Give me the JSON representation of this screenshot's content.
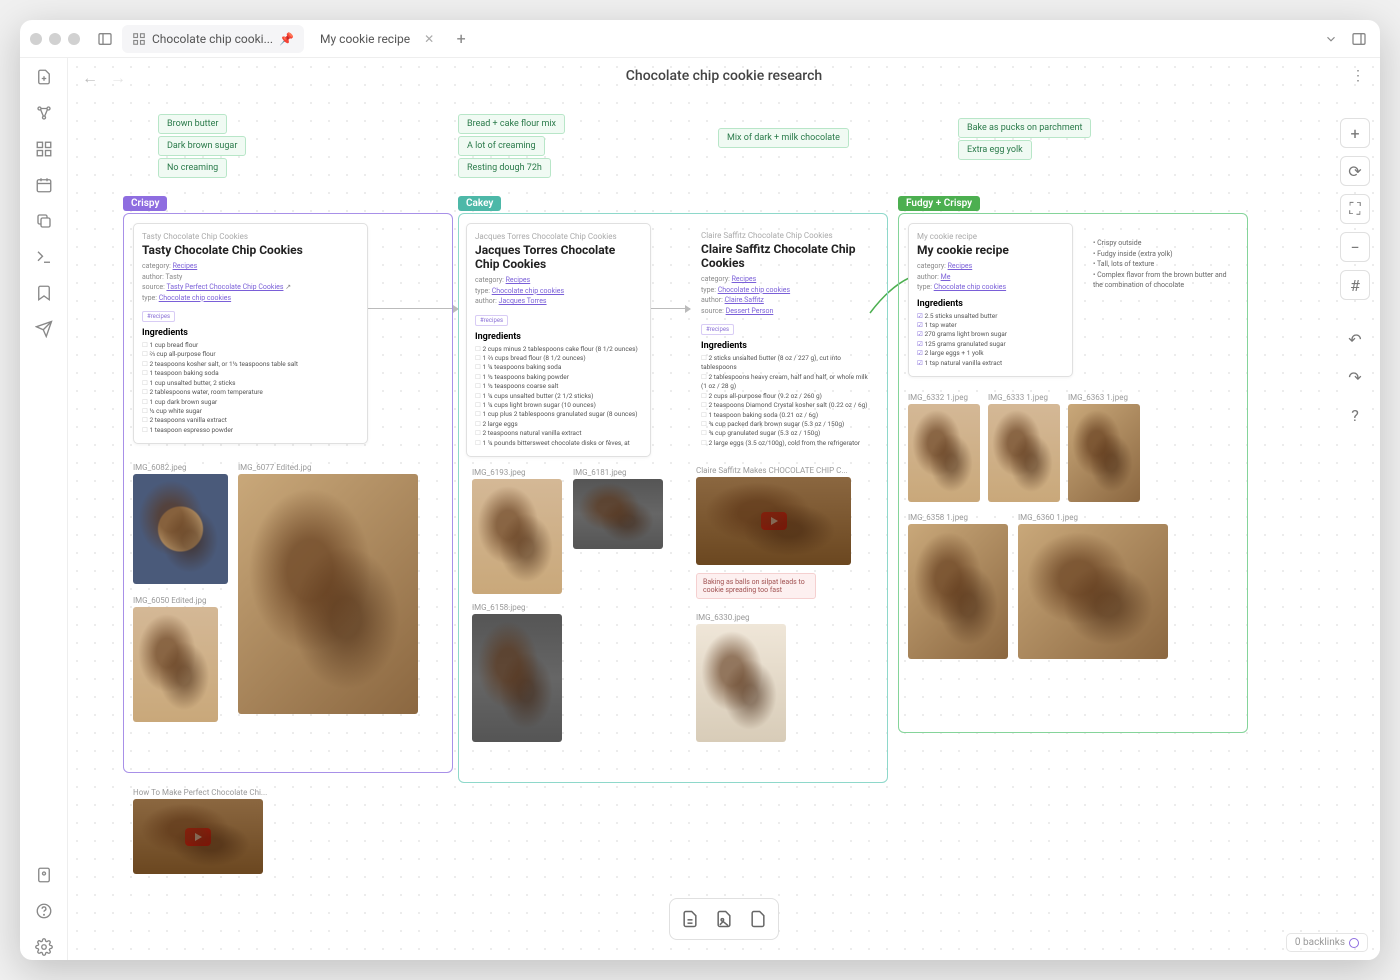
{
  "tabs": [
    {
      "label": "Chocolate chip cooki...",
      "pinned": true
    },
    {
      "label": "My cookie recipe",
      "pinned": false
    }
  ],
  "page_title": "Chocolate chip cookie research",
  "backlinks": "0 backlinks",
  "tags": {
    "col1": [
      "Brown butter",
      "Dark brown sugar",
      "No creaming"
    ],
    "col2": [
      "Bread + cake flour mix",
      "A lot of creaming",
      "Resting dough 72h"
    ],
    "col3": [
      "Mix of dark + milk chocolate"
    ],
    "col4": [
      "Bake as pucks on parchment",
      "Extra egg yolk"
    ]
  },
  "sections": {
    "crispy": {
      "label": "Crispy"
    },
    "cakey": {
      "label": "Cakey"
    },
    "fudgy": {
      "label": "Fudgy + Crispy"
    }
  },
  "cards": {
    "tasty": {
      "super": "Tasty Chocolate Chip Cookies",
      "title": "Tasty Chocolate Chip Cookies",
      "cat": "Recipes",
      "author": "Tasty",
      "source": "Tasty Perfect Chocolate Chip Cookies",
      "type": "Chocolate chip cookies",
      "chip": "#recipes",
      "heading": "Ingredients",
      "ings": [
        "1 cup bread flour",
        "⅔ cup all-purpose flour",
        "2 teaspoons kosher salt, or 1½ teaspoons table salt",
        "1 teaspoon baking soda",
        "1 cup unsalted butter, 2 sticks",
        "2 tablespoons water, room temperature",
        "1 cup dark brown sugar",
        "½ cup white sugar",
        "2 teaspoons vanilla extract",
        "1 teaspoon espresso powder"
      ]
    },
    "jacques": {
      "super": "Jacques Torres Chocolate Chip Cookies",
      "title": "Jacques Torres Chocolate Chip Cookies",
      "cat": "Recipes",
      "type": "Chocolate chip cookies",
      "author": "Jacques Torres",
      "chip": "#recipes",
      "heading": "Ingredients",
      "ings": [
        "2 cups minus 2 tablespoons cake flour (8 1/2 ounces)",
        "1 ⅔ cups bread flour (8 1/2 ounces)",
        "1 ¼ teaspoons baking soda",
        "1 ½ teaspoons baking powder",
        "1 ½ teaspoons coarse salt",
        "1 ¼ cups unsalted butter (2 1/2 sticks)",
        "1 ¼ cups light brown sugar (10 ounces)",
        "1 cup plus 2 tablespoons granulated sugar (8 ounces)",
        "2 large eggs",
        "2 teaspoons natural vanilla extract",
        "1 ¼ pounds bittersweet chocolate disks or fèves, at"
      ]
    },
    "claire": {
      "super": "Claire Saffitz Chocolate Chip Cookies",
      "title": "Claire Saffitz Chocolate Chip Cookies",
      "cat": "Recipes",
      "type": "Chocolate chip cookies",
      "author": "Claire Saffitz",
      "source": "Dessert Person",
      "chip": "#recipes",
      "heading": "Ingredients",
      "ings": [
        "2 sticks unsalted butter (8 oz / 227 g), cut into tablespoons",
        "2 tablespoons heavy cream, half and half, or whole milk (1 oz / 28 g)",
        "2 cups all-purpose flour (9.2 oz / 260 g)",
        "2 teaspoons Diamond Crystal kosher salt (0.22 oz / 6g)",
        "1 teaspoon baking soda (0.21 oz / 6g)",
        "¾ cup packed dark brown sugar (5.3 oz / 150g)",
        "¾ cup granulated sugar (5.3 oz / 150g)",
        "2 large eggs (3.5 oz/100g), cold from the refrigerator"
      ]
    },
    "mine": {
      "super": "My cookie recipe",
      "title": "My cookie recipe",
      "cat": "Recipes",
      "author": "Me",
      "type": "Chocolate chip cookies",
      "heading": "Ingredients",
      "ings": [
        "2.5 sticks unsalted butter",
        "1 tsp water",
        "270 grams light brown sugar",
        "125 grams granulated sugar",
        "2 large eggs + 1 yolk",
        "1 tsp natural vanilla extract"
      ]
    }
  },
  "side_notes": [
    "Crispy outside",
    "Fudgy inside (extra yolk)",
    "Tall, lots of texture",
    "Complex flavor from the brown butter and the combination of chocolate"
  ],
  "note_box": "Baking as balls on silpat leads to cookie spreading too fast",
  "images": {
    "c1": "IMG_6082.jpeg",
    "c2": "IMG_6077 Edited.jpg",
    "c3": "IMG_6050 Edited.jpg",
    "k1": "IMG_6193.jpeg",
    "k2": "IMG_6181.jpeg",
    "k3": "IMG_6158.jpeg",
    "v1": "Claire Saffitz Makes CHOCOLATE CHIP C...",
    "n1": "IMG_6330.jpeg",
    "m1": "IMG_6332 1.jpeg",
    "m2": "IMG_6333 1.jpeg",
    "m3": "IMG_6363 1.jpeg",
    "m4": "IMG_6358 1.jpeg",
    "m5": "IMG_6360 1.jpeg",
    "bv": "How To Make Perfect Chocolate Chi..."
  }
}
